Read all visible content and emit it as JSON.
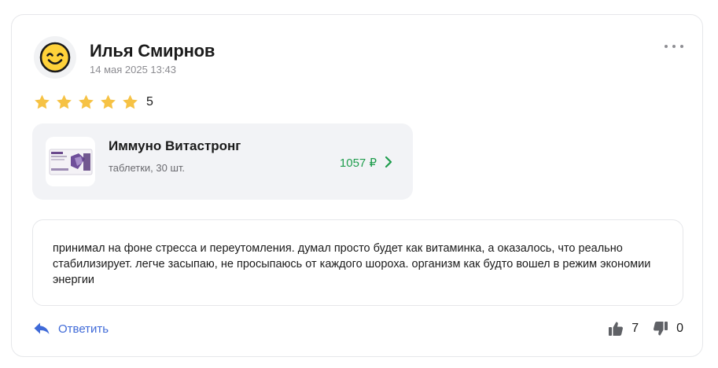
{
  "review": {
    "author": {
      "name": "Илья Смирнов",
      "avatar_icon": "smiling-face-emoji",
      "date": "14 мая 2025 13:43"
    },
    "menu_icon": "more-dots-icon",
    "rating": {
      "value": "5",
      "max": 5,
      "filled": 5,
      "icon": "star-icon",
      "color": "#f6c244"
    },
    "product": {
      "name": "Иммуно Витастронг",
      "description": "таблетки, 30 шт.",
      "price": "1057 ₽",
      "price_color": "#1f9d4d",
      "thumb_icon": "product-box-image"
    },
    "text": "принимал на фоне стресса и переутомления. думал просто будет как витаминка, а оказалось, что реально стабилизирует. легче засыпаю, не просыпаюсь от каждого шороха. организм как будто вошел в режим экономии энергии",
    "actions": {
      "reply_label": "Ответить",
      "reply_color": "#3f6ad8",
      "likes": "7",
      "dislikes": "0"
    }
  }
}
